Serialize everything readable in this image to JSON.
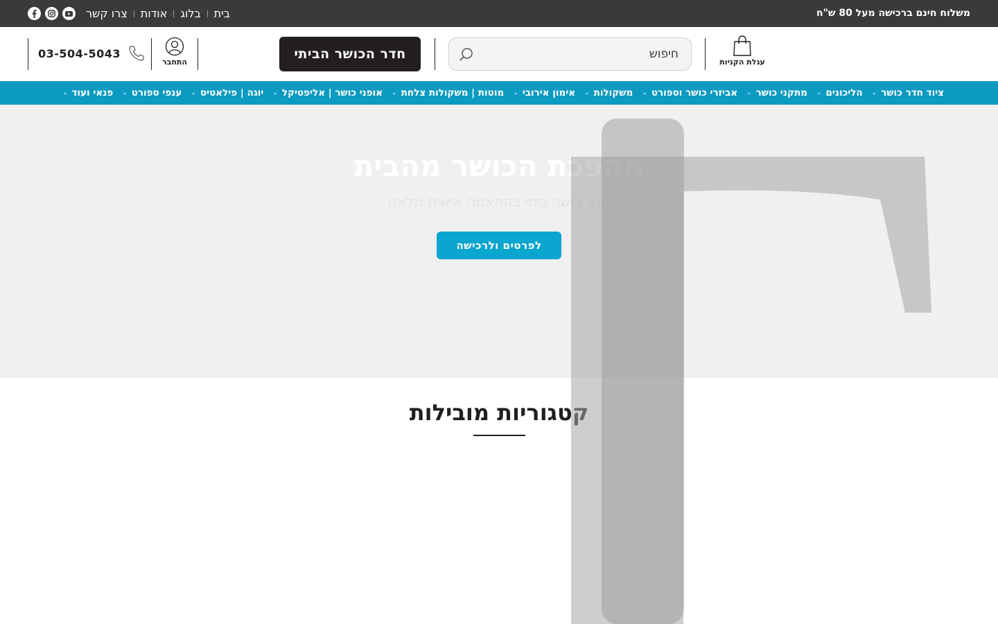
{
  "topbar": {
    "shipping": "משלוח חינם ברכישה מעל 80 ש\"ח",
    "links": [
      "בית",
      "בלוג",
      "אודות",
      "צרו קשר"
    ],
    "social": [
      "youtube-icon",
      "instagram-icon",
      "facebook-icon"
    ]
  },
  "header": {
    "cart_label": "עגלת הקניות",
    "search_placeholder": "חיפוש",
    "cta_label": "חדר הכושר הביתי",
    "login_label": "התחבר",
    "phone": "03-504-5043"
  },
  "nav": {
    "items": [
      {
        "label": "ציוד חדר כושר",
        "dropdown": true
      },
      {
        "label": "הליכונים",
        "dropdown": true
      },
      {
        "label": "מתקני כושר",
        "dropdown": true
      },
      {
        "label": "אביזרי כושר וספורט",
        "dropdown": true
      },
      {
        "label": "משקולות",
        "dropdown": true
      },
      {
        "label": "אימון אירובי",
        "dropdown": true
      },
      {
        "label": "מוטות | משקולות צלחת",
        "dropdown": true
      },
      {
        "label": "אופני כושר | אליפטיקל",
        "dropdown": true
      },
      {
        "label": "יוגה | פילאטיס",
        "dropdown": true
      },
      {
        "label": "ענפי ספורט",
        "dropdown": true
      },
      {
        "label": "פנאי ועוד",
        "dropdown": true
      }
    ]
  },
  "hero": {
    "title": "מהפכת הכושר מהבית",
    "subtitle": "חדר כושר ביתי בהתאמה אישית מלאה",
    "button_label": "לפרטים ולרכישה"
  },
  "categories": {
    "title": "קטגוריות מובילות"
  },
  "colors": {
    "topbar": "#3a3a3a",
    "nav": "#0d9ac0",
    "accent": "#0aa6cf",
    "dark_button": "#231f20"
  }
}
